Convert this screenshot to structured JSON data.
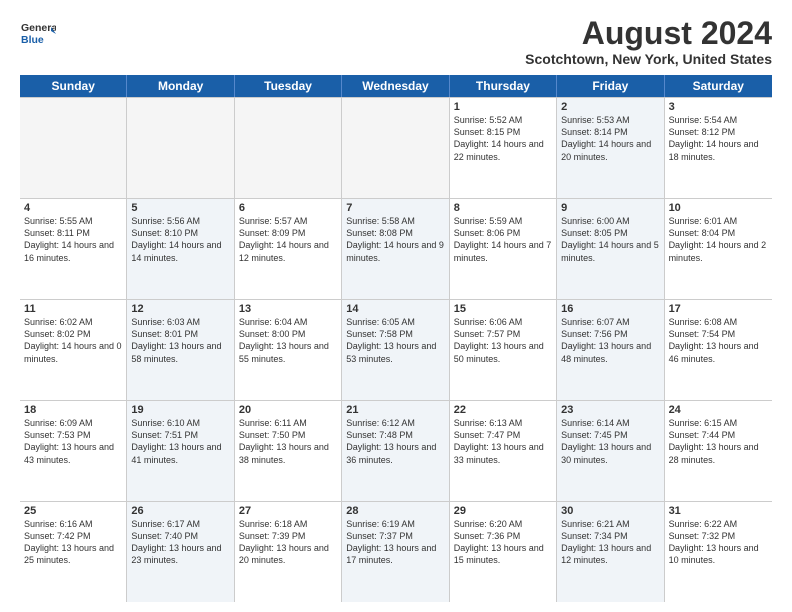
{
  "header": {
    "logo_line1": "General",
    "logo_line2": "Blue",
    "title": "August 2024",
    "subtitle": "Scotchtown, New York, United States"
  },
  "weekdays": [
    "Sunday",
    "Monday",
    "Tuesday",
    "Wednesday",
    "Thursday",
    "Friday",
    "Saturday"
  ],
  "rows": [
    [
      {
        "day": "",
        "text": "",
        "empty": true
      },
      {
        "day": "",
        "text": "",
        "empty": true
      },
      {
        "day": "",
        "text": "",
        "empty": true
      },
      {
        "day": "",
        "text": "",
        "empty": true
      },
      {
        "day": "1",
        "text": "Sunrise: 5:52 AM\nSunset: 8:15 PM\nDaylight: 14 hours\nand 22 minutes."
      },
      {
        "day": "2",
        "text": "Sunrise: 5:53 AM\nSunset: 8:14 PM\nDaylight: 14 hours\nand 20 minutes.",
        "shade": true
      },
      {
        "day": "3",
        "text": "Sunrise: 5:54 AM\nSunset: 8:12 PM\nDaylight: 14 hours\nand 18 minutes."
      }
    ],
    [
      {
        "day": "4",
        "text": "Sunrise: 5:55 AM\nSunset: 8:11 PM\nDaylight: 14 hours\nand 16 minutes."
      },
      {
        "day": "5",
        "text": "Sunrise: 5:56 AM\nSunset: 8:10 PM\nDaylight: 14 hours\nand 14 minutes.",
        "shade": true
      },
      {
        "day": "6",
        "text": "Sunrise: 5:57 AM\nSunset: 8:09 PM\nDaylight: 14 hours\nand 12 minutes."
      },
      {
        "day": "7",
        "text": "Sunrise: 5:58 AM\nSunset: 8:08 PM\nDaylight: 14 hours\nand 9 minutes.",
        "shade": true
      },
      {
        "day": "8",
        "text": "Sunrise: 5:59 AM\nSunset: 8:06 PM\nDaylight: 14 hours\nand 7 minutes."
      },
      {
        "day": "9",
        "text": "Sunrise: 6:00 AM\nSunset: 8:05 PM\nDaylight: 14 hours\nand 5 minutes.",
        "shade": true
      },
      {
        "day": "10",
        "text": "Sunrise: 6:01 AM\nSunset: 8:04 PM\nDaylight: 14 hours\nand 2 minutes."
      }
    ],
    [
      {
        "day": "11",
        "text": "Sunrise: 6:02 AM\nSunset: 8:02 PM\nDaylight: 14 hours\nand 0 minutes."
      },
      {
        "day": "12",
        "text": "Sunrise: 6:03 AM\nSunset: 8:01 PM\nDaylight: 13 hours\nand 58 minutes.",
        "shade": true
      },
      {
        "day": "13",
        "text": "Sunrise: 6:04 AM\nSunset: 8:00 PM\nDaylight: 13 hours\nand 55 minutes."
      },
      {
        "day": "14",
        "text": "Sunrise: 6:05 AM\nSunset: 7:58 PM\nDaylight: 13 hours\nand 53 minutes.",
        "shade": true
      },
      {
        "day": "15",
        "text": "Sunrise: 6:06 AM\nSunset: 7:57 PM\nDaylight: 13 hours\nand 50 minutes."
      },
      {
        "day": "16",
        "text": "Sunrise: 6:07 AM\nSunset: 7:56 PM\nDaylight: 13 hours\nand 48 minutes.",
        "shade": true
      },
      {
        "day": "17",
        "text": "Sunrise: 6:08 AM\nSunset: 7:54 PM\nDaylight: 13 hours\nand 46 minutes."
      }
    ],
    [
      {
        "day": "18",
        "text": "Sunrise: 6:09 AM\nSunset: 7:53 PM\nDaylight: 13 hours\nand 43 minutes."
      },
      {
        "day": "19",
        "text": "Sunrise: 6:10 AM\nSunset: 7:51 PM\nDaylight: 13 hours\nand 41 minutes.",
        "shade": true
      },
      {
        "day": "20",
        "text": "Sunrise: 6:11 AM\nSunset: 7:50 PM\nDaylight: 13 hours\nand 38 minutes."
      },
      {
        "day": "21",
        "text": "Sunrise: 6:12 AM\nSunset: 7:48 PM\nDaylight: 13 hours\nand 36 minutes.",
        "shade": true
      },
      {
        "day": "22",
        "text": "Sunrise: 6:13 AM\nSunset: 7:47 PM\nDaylight: 13 hours\nand 33 minutes."
      },
      {
        "day": "23",
        "text": "Sunrise: 6:14 AM\nSunset: 7:45 PM\nDaylight: 13 hours\nand 30 minutes.",
        "shade": true
      },
      {
        "day": "24",
        "text": "Sunrise: 6:15 AM\nSunset: 7:44 PM\nDaylight: 13 hours\nand 28 minutes."
      }
    ],
    [
      {
        "day": "25",
        "text": "Sunrise: 6:16 AM\nSunset: 7:42 PM\nDaylight: 13 hours\nand 25 minutes."
      },
      {
        "day": "26",
        "text": "Sunrise: 6:17 AM\nSunset: 7:40 PM\nDaylight: 13 hours\nand 23 minutes.",
        "shade": true
      },
      {
        "day": "27",
        "text": "Sunrise: 6:18 AM\nSunset: 7:39 PM\nDaylight: 13 hours\nand 20 minutes."
      },
      {
        "day": "28",
        "text": "Sunrise: 6:19 AM\nSunset: 7:37 PM\nDaylight: 13 hours\nand 17 minutes.",
        "shade": true
      },
      {
        "day": "29",
        "text": "Sunrise: 6:20 AM\nSunset: 7:36 PM\nDaylight: 13 hours\nand 15 minutes."
      },
      {
        "day": "30",
        "text": "Sunrise: 6:21 AM\nSunset: 7:34 PM\nDaylight: 13 hours\nand 12 minutes.",
        "shade": true
      },
      {
        "day": "31",
        "text": "Sunrise: 6:22 AM\nSunset: 7:32 PM\nDaylight: 13 hours\nand 10 minutes."
      }
    ]
  ]
}
